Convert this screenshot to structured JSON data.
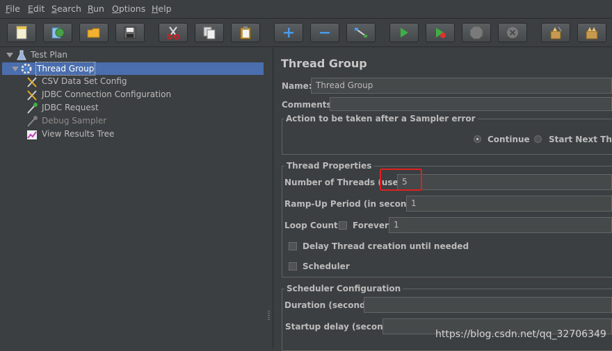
{
  "menu": [
    {
      "mnemonic": "F",
      "rest": "ile"
    },
    {
      "mnemonic": "E",
      "rest": "dit"
    },
    {
      "mnemonic": "S",
      "rest": "earch"
    },
    {
      "mnemonic": "R",
      "rest": "un"
    },
    {
      "mnemonic": "O",
      "rest": "ptions"
    },
    {
      "mnemonic": "H",
      "rest": "elp"
    }
  ],
  "toolbar_icons": [
    "new-icon",
    "templates-icon",
    "open-icon",
    "save-icon",
    "cut-icon",
    "copy-icon",
    "paste-icon",
    "expand-icon",
    "collapse-icon",
    "toggle-icon",
    "start-icon",
    "start-no-pauses-icon",
    "stop-icon",
    "shutdown-icon",
    "clear-icon",
    "clear-all-icon"
  ],
  "tree": {
    "test_plan": "Test Plan",
    "thread_group": "Thread Group",
    "children": [
      "CSV Data Set Config",
      "JDBC Connection Configuration",
      "JDBC Request",
      "Debug Sampler",
      "View Results Tree"
    ]
  },
  "panel": {
    "title": "Thread Group",
    "name_label": "Name:",
    "name_value": "Thread Group",
    "comments_label": "Comments:",
    "sampler_error": {
      "legend": "Action to be taken after a Sampler error",
      "options": [
        "Continue",
        "Start Next Threa"
      ],
      "selected": "Continue"
    },
    "thread_props": {
      "legend": "Thread Properties",
      "threads_label": "Number of Threads (users):",
      "threads_value": "5",
      "rampup_label": "Ramp-Up Period (in seconds):",
      "rampup_value": "1",
      "loop_label": "Loop Count:",
      "forever_label": "Forever",
      "loop_value": "1",
      "delay_label": "Delay Thread creation until needed",
      "scheduler_label": "Scheduler"
    },
    "scheduler_config": {
      "legend": "Scheduler Configuration",
      "duration_label": "Duration (seconds)",
      "startup_label": "Startup delay (seconds)"
    }
  },
  "watermark": "https://blog.csdn.net/qq_32706349",
  "colors": {
    "selection": "#4b6eaf",
    "highlight_box": "#e0201e",
    "background": "#3c3f41"
  }
}
